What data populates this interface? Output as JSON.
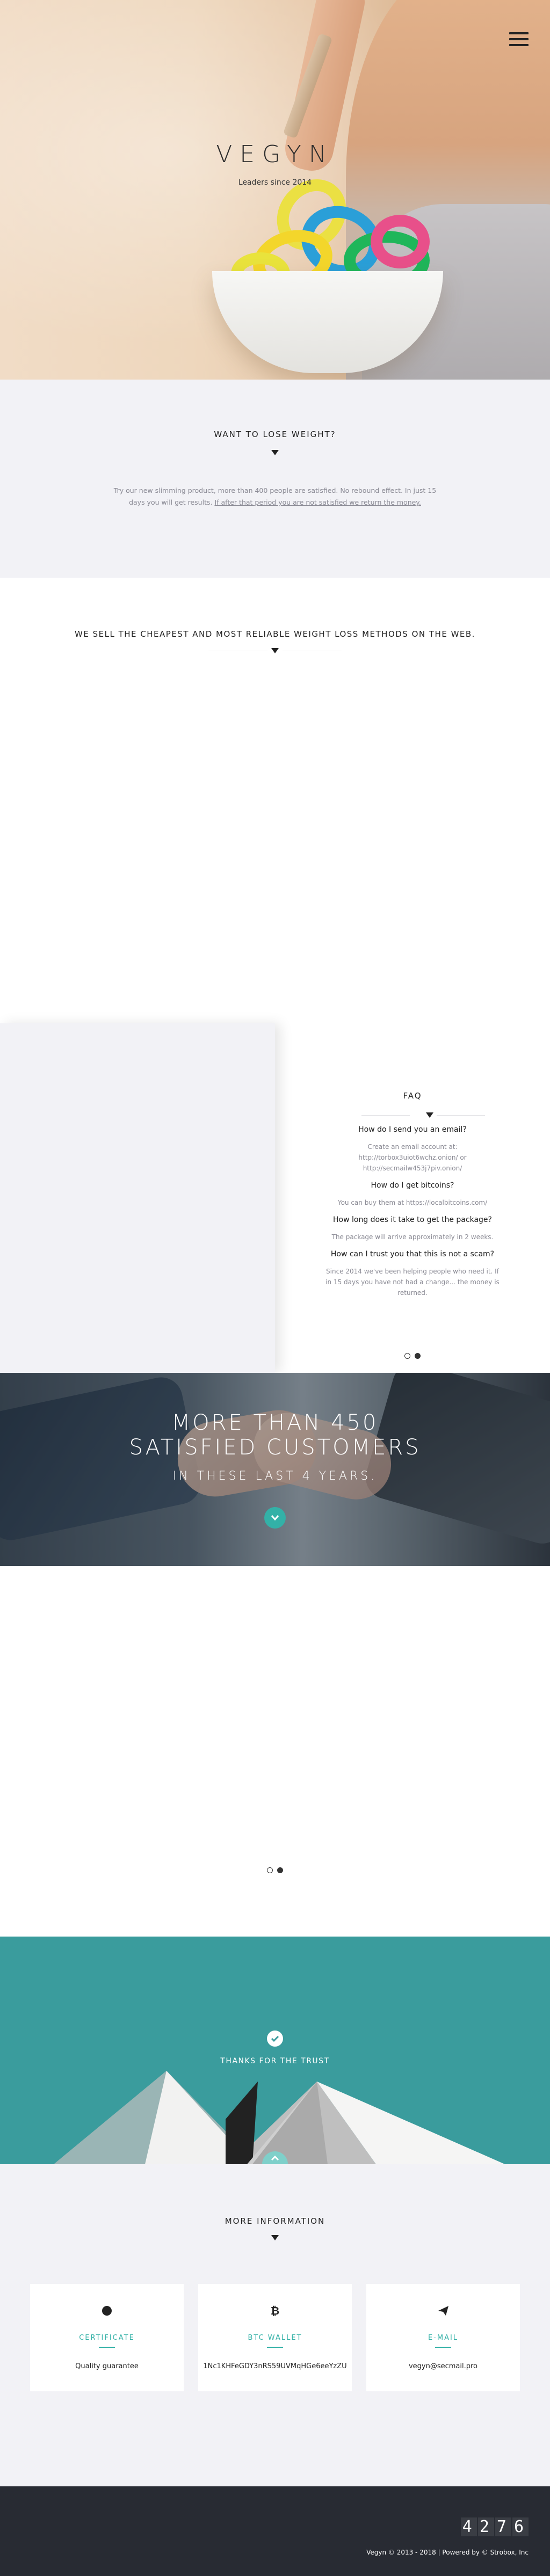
{
  "hero": {
    "brand": "VEGYN",
    "tagline": "Leaders since 2014"
  },
  "intro": {
    "title": "WANT TO LOSE WEIGHT?",
    "text": "Try our new slimming product, more than 400 people are satisfied. No rebound effect. In just 15 days you will get results. ",
    "link": "If after that period you are not satisfied we return the money."
  },
  "methods": {
    "title": "WE SELL THE CHEAPEST AND MOST RELIABLE WEIGHT LOSS METHODS ON THE WEB."
  },
  "faq": {
    "title": "FAQ",
    "items": [
      {
        "q": "How do I send you an email?",
        "a": "Create an email account at: http://torbox3uiot6wchz.onion/ or http://secmailw453j7piv.onion/"
      },
      {
        "q": "How do I get bitcoins?",
        "a": "You can buy them at https://localbitcoins.com/"
      },
      {
        "q": "How long does it take to get the package?",
        "a": "The package will arrive approximately in 2 weeks."
      },
      {
        "q": "How can I trust you that this is not a scam?",
        "a": "Since 2014 we've been helping people who need it. If in 15 days you have not had a change... the money is returned."
      }
    ]
  },
  "customers": {
    "line1": "MORE THAN 450",
    "line2": "SATISFIED CUSTOMERS",
    "line3": "IN THESE LAST 4 YEARS."
  },
  "trust": {
    "label": "THANKS FOR THE TRUST"
  },
  "more_info": {
    "title": "MORE INFORMATION",
    "cards": [
      {
        "icon": "circle-icon",
        "label": "CERTIFICATE",
        "value": "Quality guarantee"
      },
      {
        "icon": "bitcoin-icon",
        "label": "BTC WALLET",
        "value": "1Nc1KHFeGDY3nRS59UVMqHGe6eeYzZU"
      },
      {
        "icon": "paper-plane-icon",
        "label": "E-MAIL",
        "value": "vegyn@secmail.pro"
      }
    ]
  },
  "footer": {
    "counter": "4276",
    "copyright": "Vegyn © 2013 - 2018 | Powered by © Strobox, Inc"
  },
  "colors": {
    "accent": "#33b1a7",
    "teal_bg": "#3a9c9d",
    "footer_bg": "#282b33",
    "light_bg": "#f2f2f6"
  }
}
